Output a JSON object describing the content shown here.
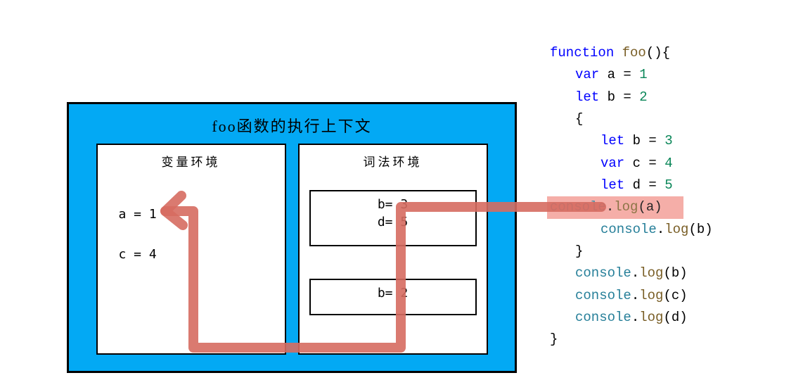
{
  "diagram": {
    "title": "foo函数的执行上下文",
    "variableEnv": {
      "title": "变量环境",
      "var_a": "a = 1",
      "var_c": "c = 4"
    },
    "lexicalEnv": {
      "title": "词法环境",
      "block1": {
        "var_b": "b= 3",
        "var_d": "d= 5"
      },
      "block2": {
        "var_b": "b= 2"
      }
    }
  },
  "code": {
    "line1_kw": "function",
    "line1_name": " foo",
    "line1_paren": "(){",
    "line2_decl": "var",
    "line2_rest": " a = ",
    "line2_num": "1",
    "line3_decl": "let",
    "line3_rest": " b = ",
    "line3_num": "2",
    "line4": "{",
    "line5_decl": "let",
    "line5_rest": " b = ",
    "line5_num": "3",
    "line6_decl": "var",
    "line6_rest": " c = ",
    "line6_num": "4",
    "line7_decl": "let",
    "line7_rest": " d = ",
    "line7_num": "5",
    "line8_obj": "console",
    "line8_dot": ".",
    "line8_method": "log",
    "line8_arg": "(a)",
    "line9_obj": "console",
    "line9_dot": ".",
    "line9_method": "log",
    "line9_arg": "(b)",
    "line10": "}",
    "line11_obj": "console",
    "line11_dot": ".",
    "line11_method": "log",
    "line11_arg": "(b)",
    "line12_obj": "console",
    "line12_dot": ".",
    "line12_method": "log",
    "line12_arg": "(c)",
    "line13_obj": "console",
    "line13_dot": ".",
    "line13_method": "log",
    "line13_arg": "(d)",
    "line14": "}"
  }
}
